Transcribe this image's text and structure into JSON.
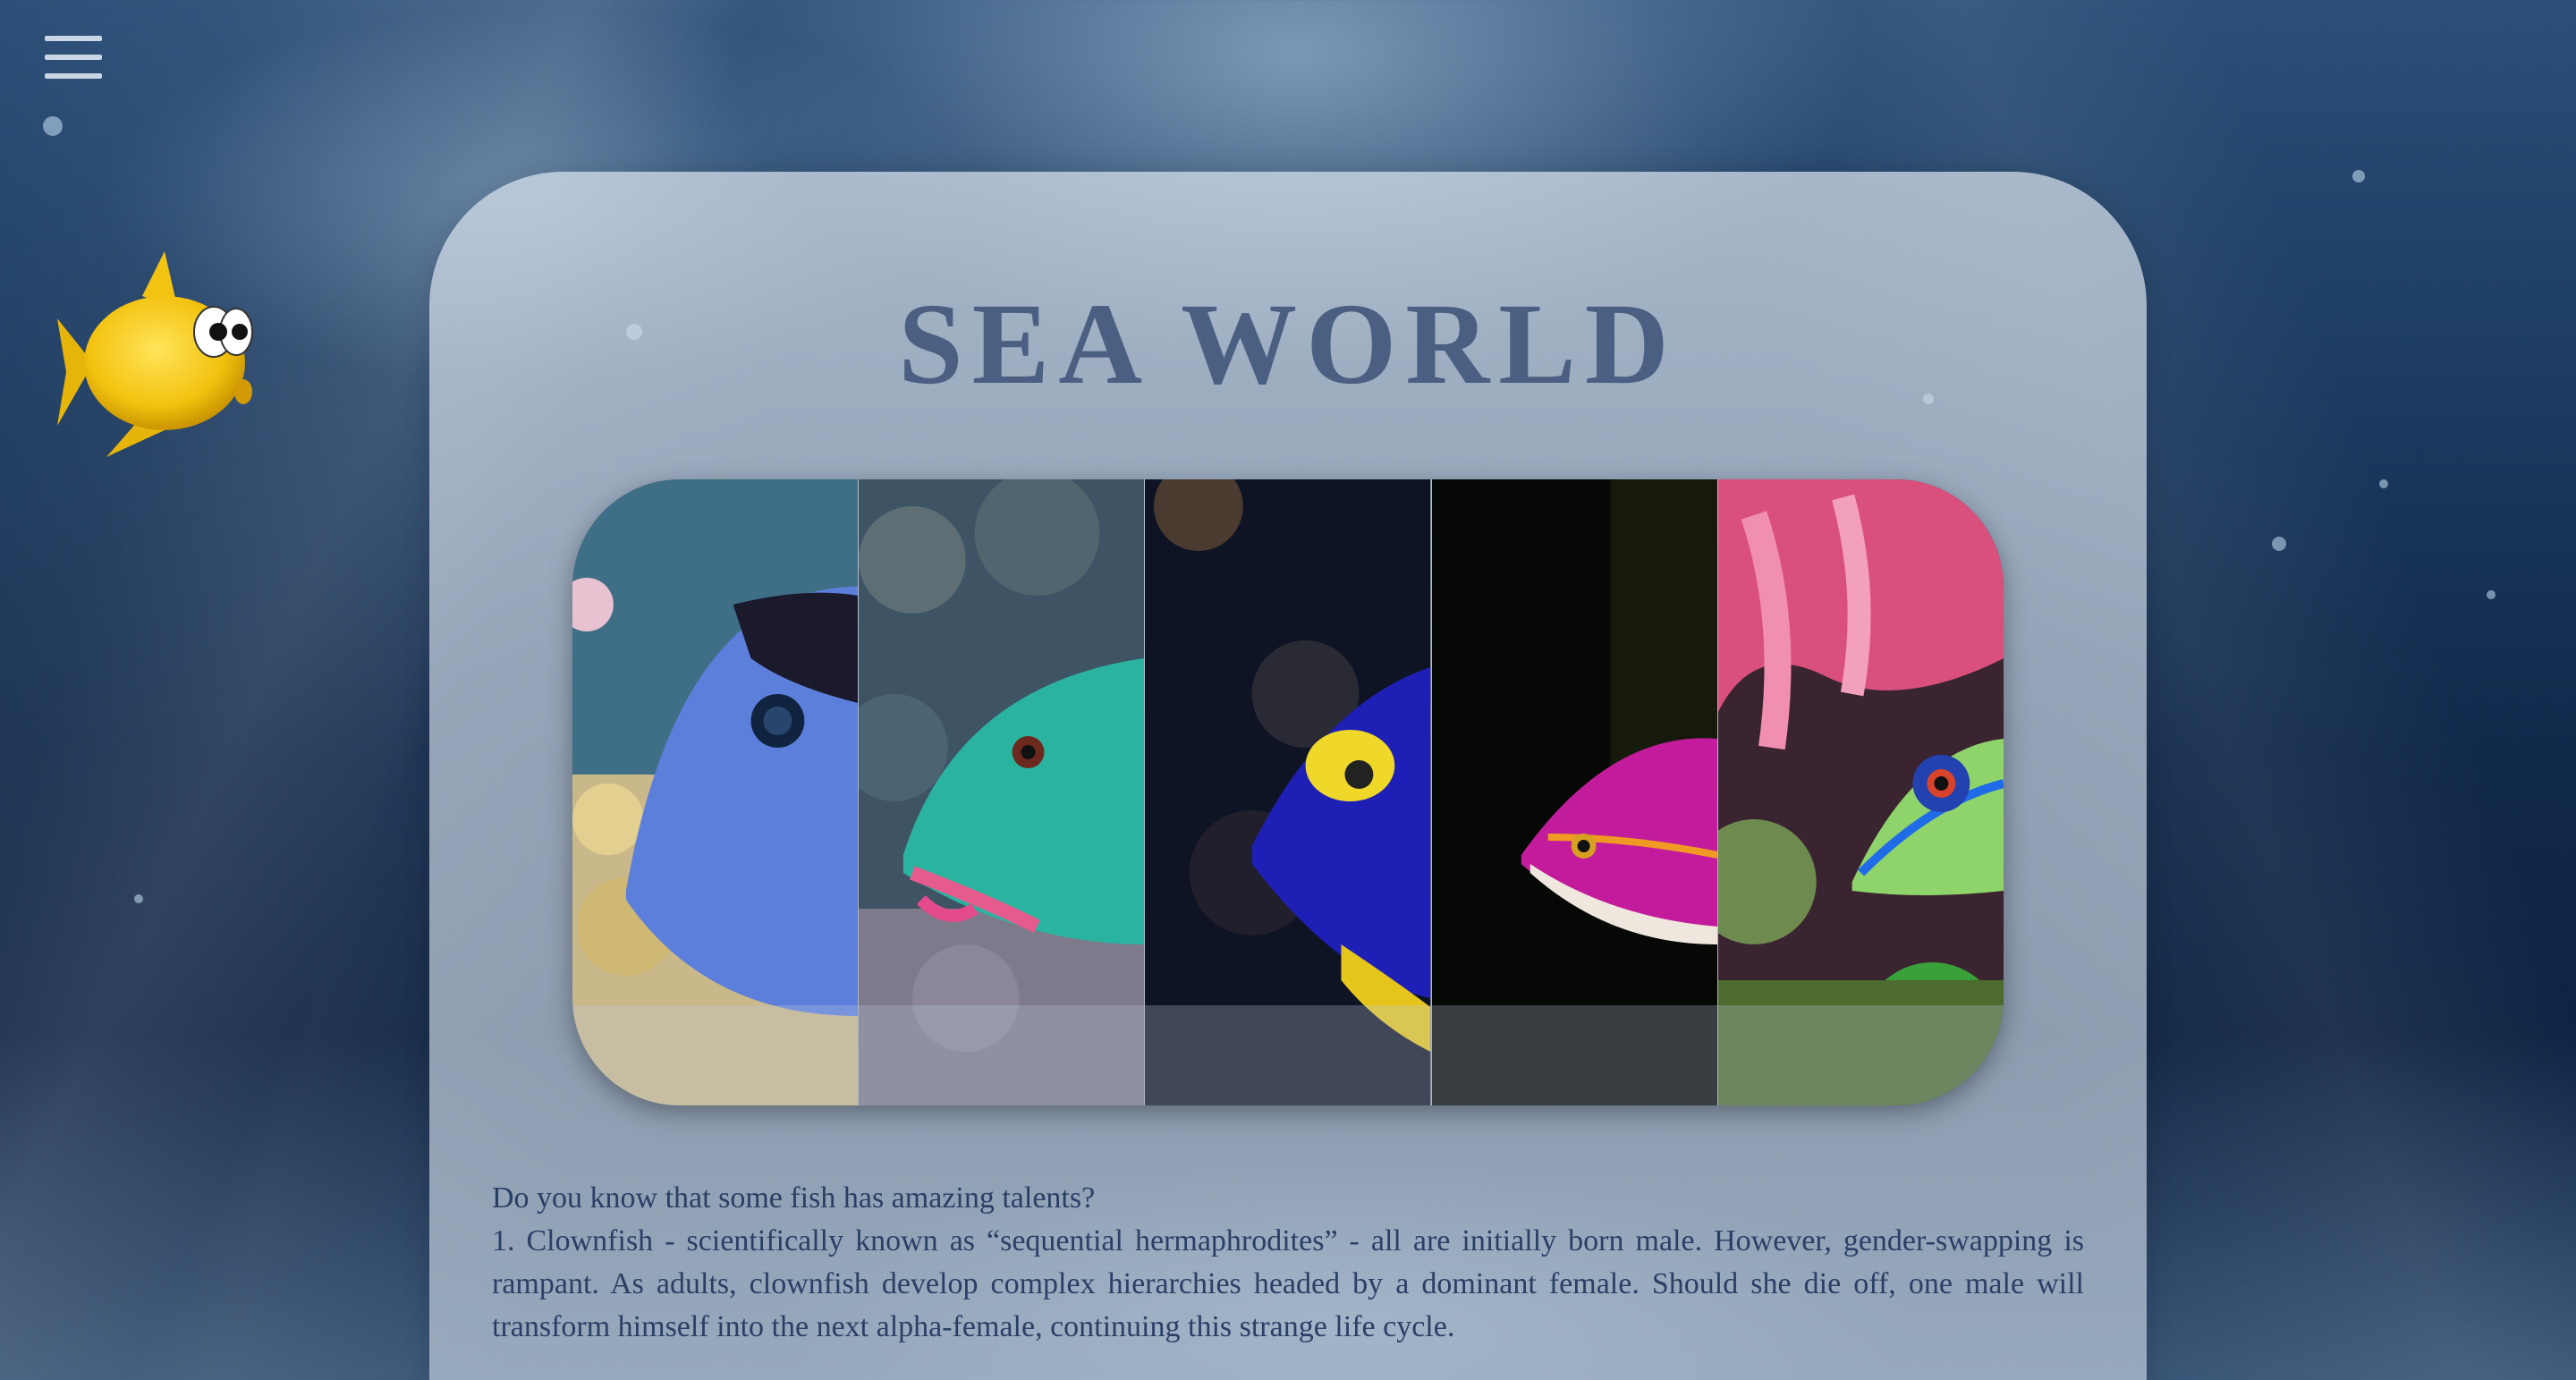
{
  "header": {
    "menu_icon": "hamburger-menu-icon",
    "mascot": "yellow-fish-cartoon"
  },
  "page": {
    "title": "SEA WORLD"
  },
  "gallery": {
    "panels": [
      {
        "subject": "blue-tang-fish"
      },
      {
        "subject": "parrotfish"
      },
      {
        "subject": "blue-angelfish"
      },
      {
        "subject": "magenta-fish"
      },
      {
        "subject": "neon-goby"
      }
    ]
  },
  "content": {
    "intro": "Do you know that some fish has amazing talents?",
    "fact_1": "1. Clownfish - scientifically known as “sequential hermaphrodites” - all are initially born male. However, gender-swapping is rampant. As adults, clownfish develop complex hierarchies headed by a dominant female. Should she die off, one male will transform himself into the next alpha-female, continuing this strange life cycle."
  },
  "colors": {
    "title": "#4b5f82",
    "text": "#2a3f66",
    "background": "#1d3d63"
  }
}
